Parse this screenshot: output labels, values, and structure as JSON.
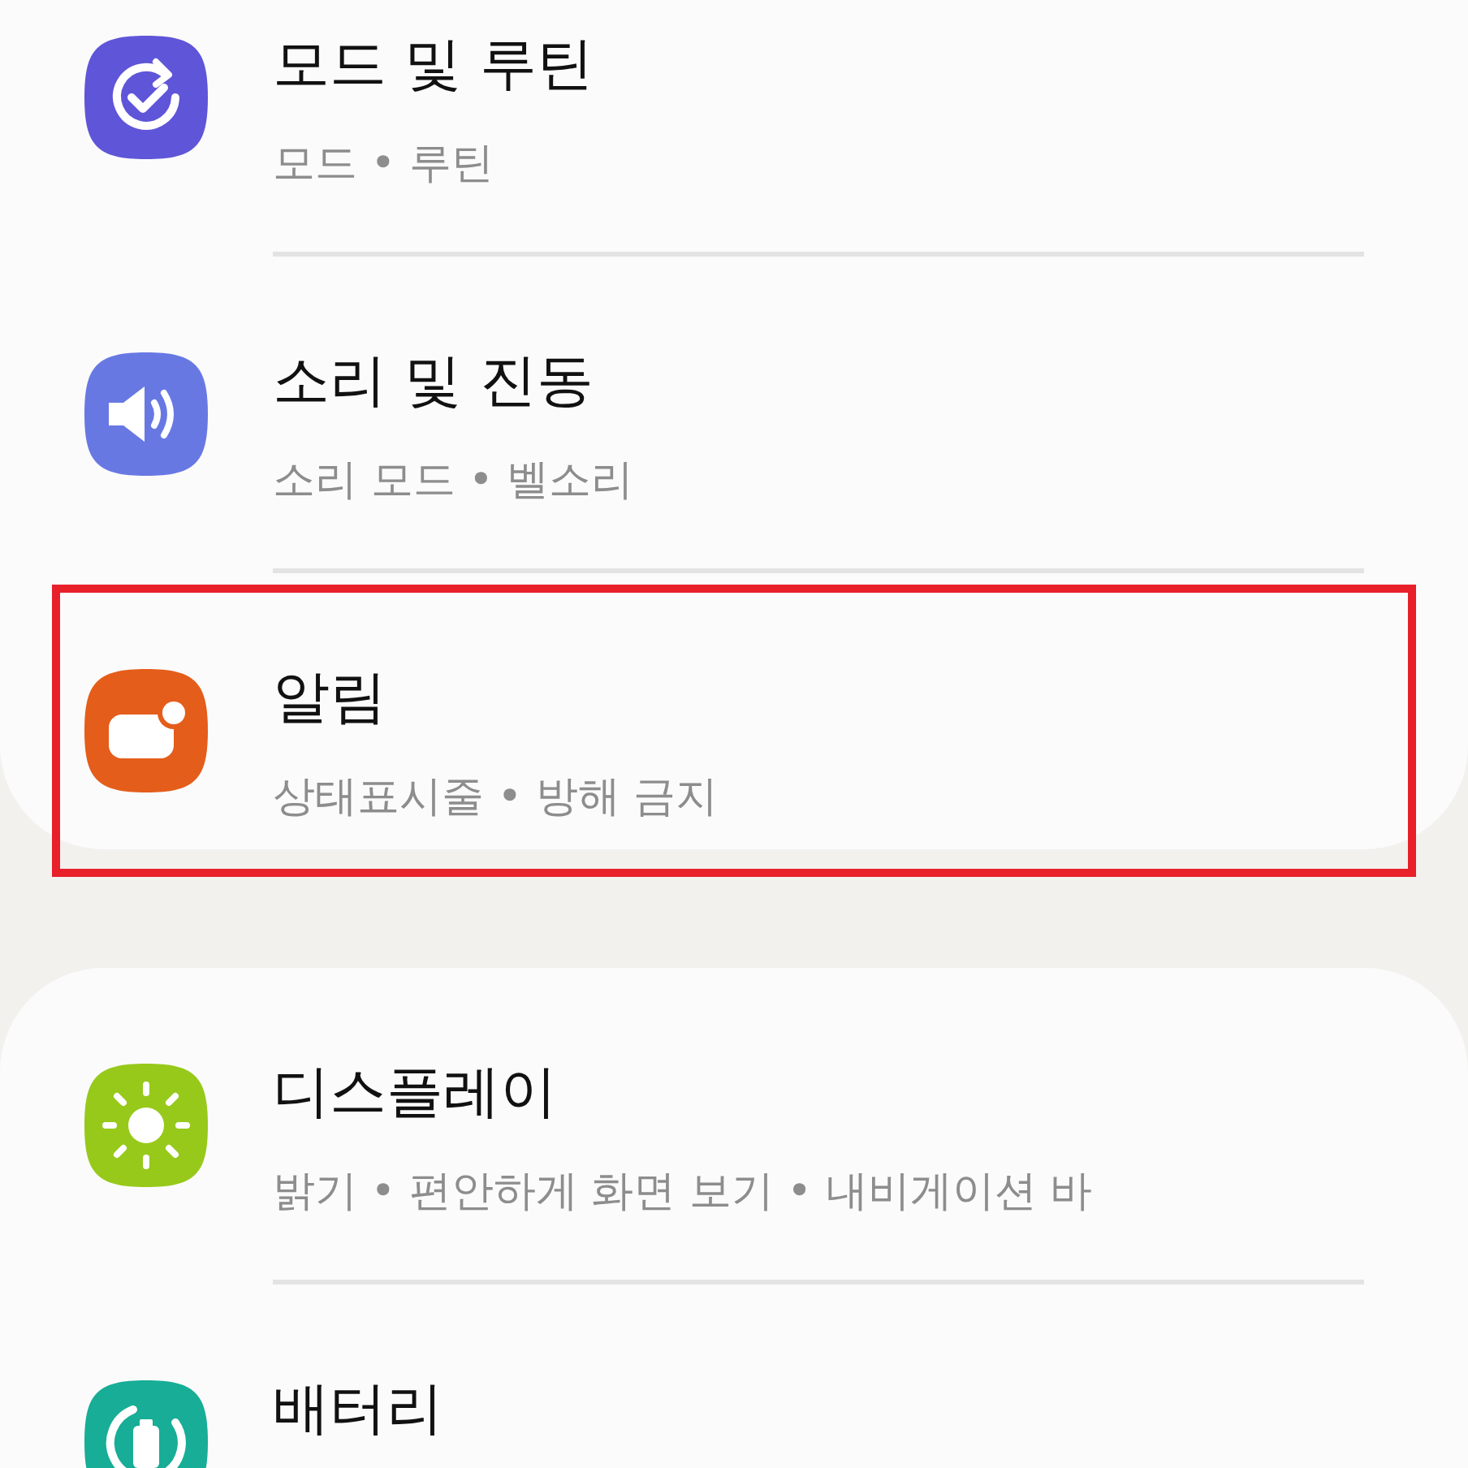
{
  "groups": [
    {
      "items": [
        {
          "kind": "routine",
          "title": "모드 및 루틴",
          "subtitle": "모드  •  루틴",
          "highlighted": false
        },
        {
          "kind": "sound",
          "title": "소리 및 진동",
          "subtitle": "소리 모드  •  벨소리",
          "highlighted": false
        },
        {
          "kind": "notification",
          "title": "알림",
          "subtitle": "상태표시줄  •  방해 금지",
          "highlighted": true
        }
      ]
    },
    {
      "items": [
        {
          "kind": "display",
          "title": "디스플레이",
          "subtitle": "밝기  •  편안하게 화면 보기  •  내비게이션 바",
          "highlighted": false
        },
        {
          "kind": "battery",
          "title": "배터리",
          "highlighted": false
        }
      ]
    }
  ]
}
